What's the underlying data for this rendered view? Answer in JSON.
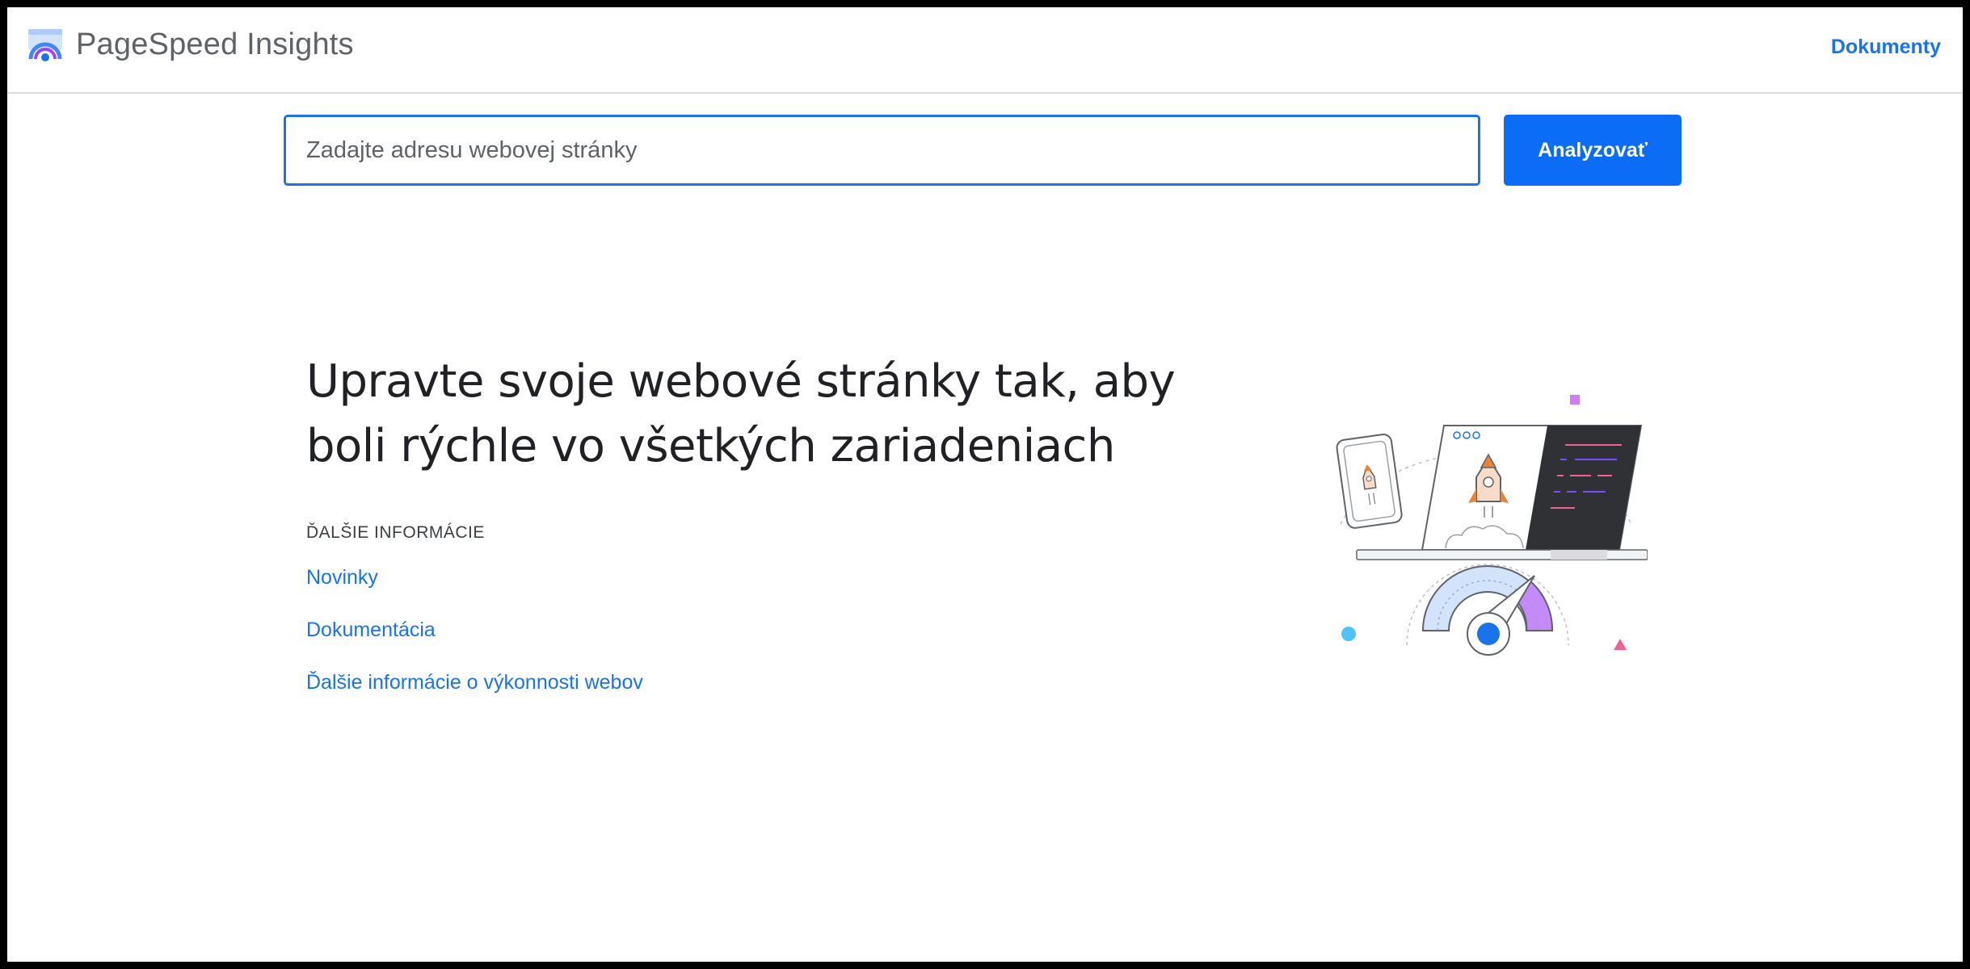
{
  "header": {
    "app_title": "PageSpeed Insights",
    "docs_link": "Dokumenty"
  },
  "search": {
    "placeholder": "Zadajte adresu webovej stránky",
    "value": "",
    "button_label": "Analyzovať"
  },
  "main": {
    "headline_line1": "Upravte svoje webové stránky tak, aby",
    "headline_line2": "boli rýchle vo všetkých zariadeniach",
    "learn_more_label": "ĎALŠIE INFORMÁCIE",
    "links": [
      {
        "label": "Novinky"
      },
      {
        "label": "Dokumentácia"
      },
      {
        "label": "Ďalšie informácie o výkonnosti webov"
      }
    ]
  },
  "colors": {
    "accent": "#1a73e8",
    "button": "#0b6cf5",
    "text": "#202124"
  },
  "icons": {
    "logo": "pagespeed-logo-icon",
    "illustration": "speed-devices-illustration"
  }
}
